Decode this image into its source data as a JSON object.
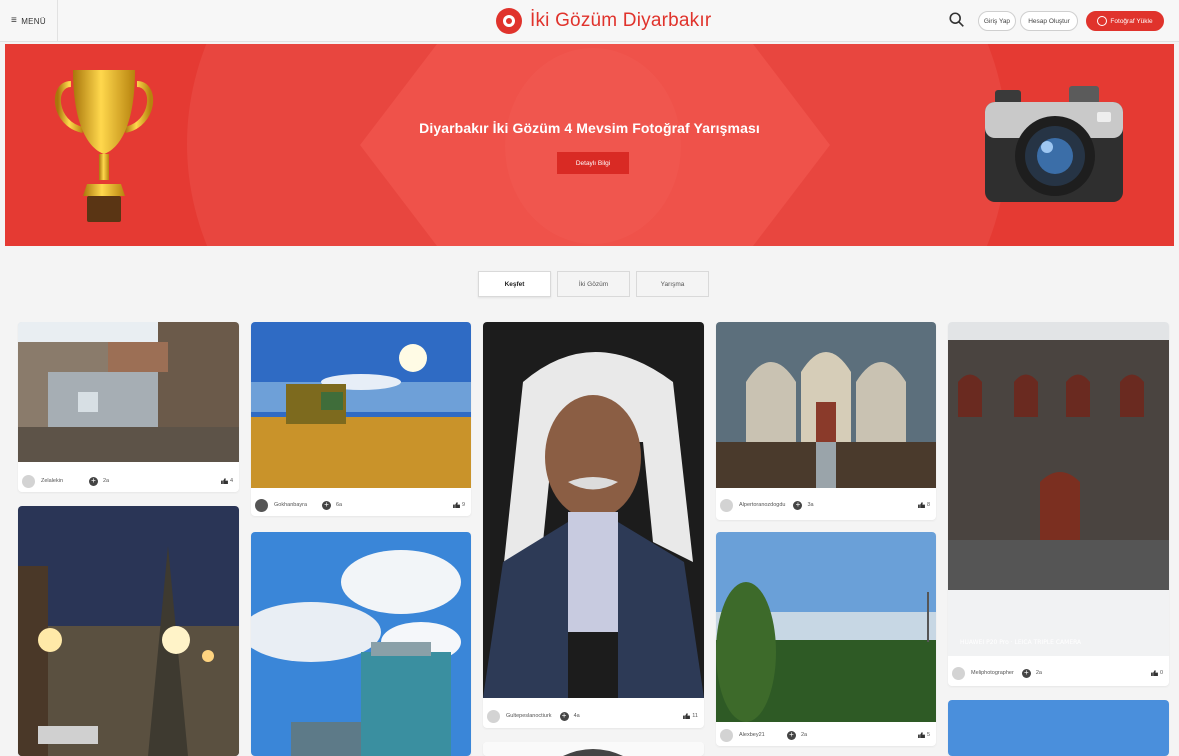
{
  "header": {
    "menu_label": "MENÜ",
    "brand": "İki Gözüm Diyarbakır",
    "login": "Giriş Yap",
    "register": "Hesap Oluştur",
    "upload": "Fotoğraf Yükle"
  },
  "banner": {
    "title": "Diyarbakır İki Gözüm 4 Mevsim Fotoğraf Yarışması",
    "button": "Detaylı Bilgi"
  },
  "tabs": [
    "Keşfet",
    "İki Gözüm",
    "Yarışma"
  ],
  "cards": [
    {
      "user": "Zelalekin",
      "age": "2a",
      "likes": "4"
    },
    {
      "user": "Gokhanbayra",
      "age": "6a",
      "likes": "9"
    },
    {
      "user": "Gultepeslanoctiurk",
      "age": "4a",
      "likes": "11"
    },
    {
      "user": "Alpertoranozdogdu",
      "age": "3a",
      "likes": "8"
    },
    {
      "user": "Meliphotographer",
      "age": "2a",
      "likes": "0"
    },
    {
      "user": "Alexbey21",
      "age": "2a",
      "likes": "5"
    }
  ],
  "watermark": "HUAWEI P20 Pro · LEICA TRIPLE CAMERA"
}
